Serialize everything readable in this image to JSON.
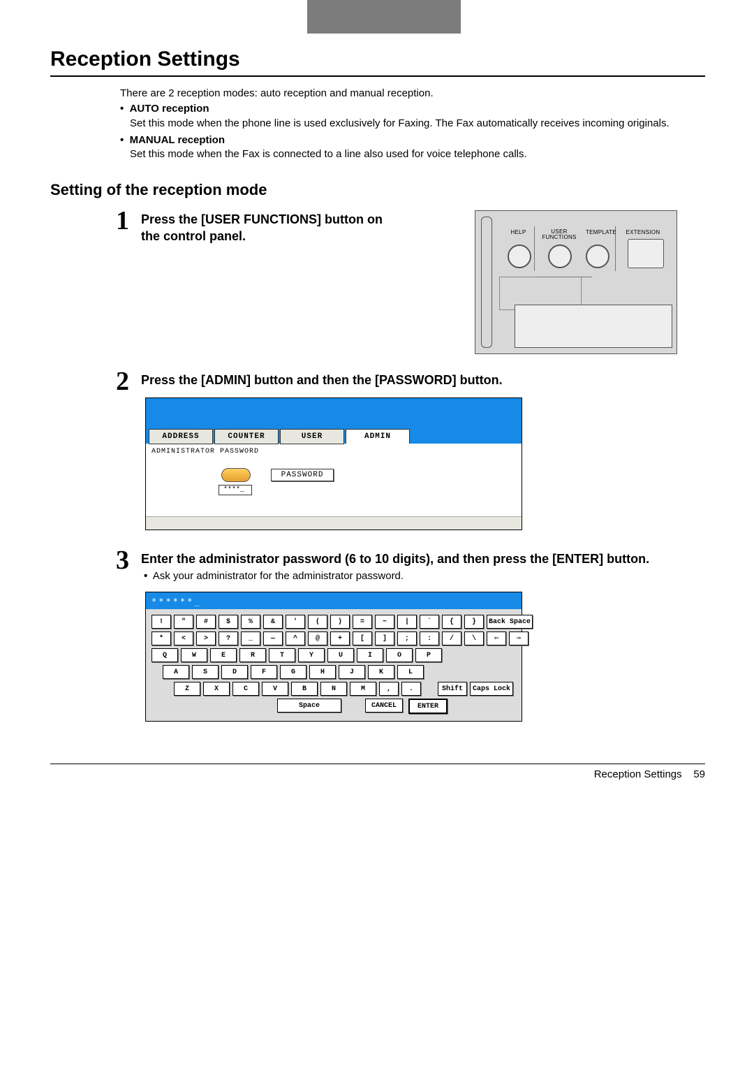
{
  "header_tab": "",
  "h1": "Reception Settings",
  "intro": {
    "lead": "There are 2 reception modes: auto reception and manual reception.",
    "auto_title": "AUTO reception",
    "auto_body": "Set this mode when the phone line is used exclusively for Faxing. The Fax automatically receives incoming originals.",
    "manual_title": "MANUAL reception",
    "manual_body": "Set this mode when the Fax is connected to a line also used for voice telephone calls."
  },
  "h2": "Setting of the reception mode",
  "steps": {
    "s1_num": "1",
    "s1_title": "Press the [USER FUNCTIONS] button on the control panel.",
    "s2_num": "2",
    "s2_title": "Press the [ADMIN] button and then the [PASSWORD] button.",
    "s3_num": "3",
    "s3_title": "Enter the administrator password (6 to 10 digits), and then press the [ENTER] button.",
    "s3_sub": "Ask your administrator for the administrator password."
  },
  "panel": {
    "help": "HELP",
    "user1": "USER",
    "user2": "FUNCTIONS",
    "template": "TEMPLATE",
    "extension": "EXTENSION"
  },
  "screen2": {
    "tabs": {
      "address": "ADDRESS",
      "counter": "COUNTER",
      "user": "USER",
      "admin": "ADMIN"
    },
    "label": "ADMINISTRATOR PASSWORD",
    "password_btn": "PASSWORD",
    "masked": "****_"
  },
  "keyboard": {
    "entry": "******_",
    "row1": [
      "!",
      "\"",
      "#",
      "$",
      "%",
      "&",
      "'",
      "(",
      ")",
      "=",
      "~",
      "|",
      "`",
      "{",
      "}"
    ],
    "row1_extra": "Back Space",
    "row2": [
      "*",
      "<",
      ">",
      "?",
      "_",
      "—",
      "^",
      "@",
      "+",
      "[",
      "]",
      ";",
      ":",
      "/",
      "\\"
    ],
    "row2_left": "⇦",
    "row2_right": "⇨",
    "row3": [
      "Q",
      "W",
      "E",
      "R",
      "T",
      "Y",
      "U",
      "I",
      "O",
      "P"
    ],
    "row4": [
      "A",
      "S",
      "D",
      "F",
      "G",
      "H",
      "J",
      "K",
      "L"
    ],
    "row5": [
      "Z",
      "X",
      "C",
      "V",
      "B",
      "N",
      "M",
      ",",
      "."
    ],
    "row5_shift": "Shift",
    "row5_caps": "Caps Lock",
    "row6_space": "Space",
    "row6_cancel": "CANCEL",
    "row6_enter": "ENTER"
  },
  "footer": {
    "title": "Reception Settings",
    "page": "59"
  }
}
